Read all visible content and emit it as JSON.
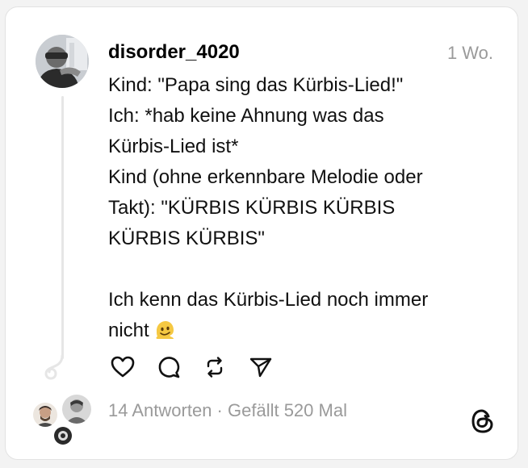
{
  "post": {
    "username": "disorder_4020",
    "time": "1 Wo.",
    "lines": [
      "Kind: \"Papa sing das Kürbis-Lied!\"",
      "Ich: *hab keine Ahnung was das",
      "Kürbis-Lied ist*",
      "Kind (ohne erkennbare Melodie oder",
      "Takt): \"KÜRBIS KÜRBIS KÜRBIS",
      "KÜRBIS KÜRBIS\"",
      "Ich kenn das Kürbis-Lied noch immer",
      "nicht"
    ],
    "emoji": "melting-face-emoji"
  },
  "actions": {
    "like": "heart-icon",
    "reply": "comment-icon",
    "repost": "repost-icon",
    "share": "send-icon"
  },
  "stats": {
    "replies": "14 Antworten",
    "separator": " · ",
    "likes": "Gefällt 520 Mal"
  },
  "colors": {
    "text": "#111111",
    "muted": "#9a9a9a",
    "line": "#e6e6e6",
    "emoji": "#f5c842"
  }
}
